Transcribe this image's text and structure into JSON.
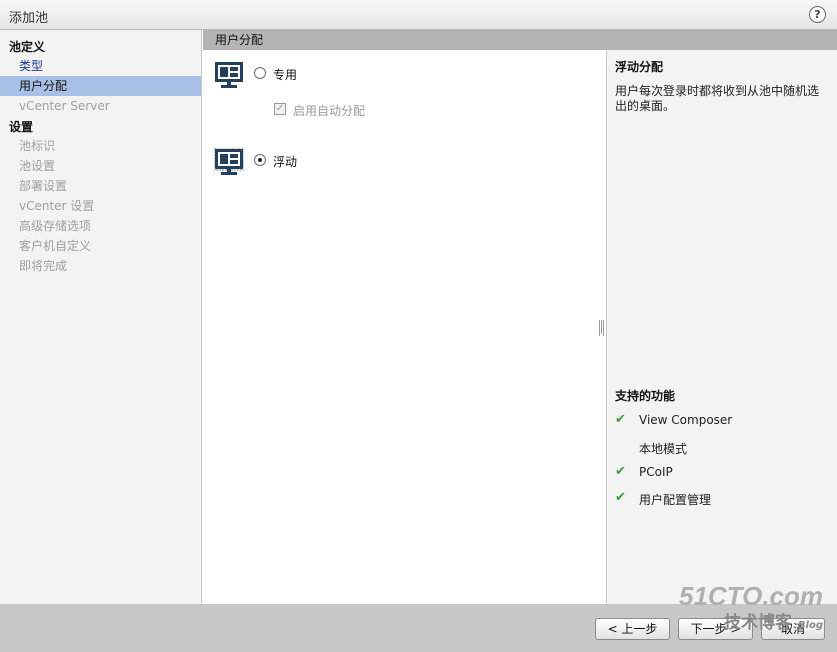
{
  "window": {
    "title": "添加池",
    "help_glyph": "?"
  },
  "sidebar": {
    "group_definition": "池定义",
    "items_definition": [
      {
        "label": "类型",
        "state": "done"
      },
      {
        "label": "用户分配",
        "state": "active"
      },
      {
        "label": "vCenter Server",
        "state": "pending"
      }
    ],
    "group_settings": "设置",
    "items_settings": [
      {
        "label": "池标识"
      },
      {
        "label": "池设置"
      },
      {
        "label": "部署设置"
      },
      {
        "label": "vCenter 设置"
      },
      {
        "label": "高级存储选项"
      },
      {
        "label": "客户机自定义"
      },
      {
        "label": "即将完成"
      }
    ]
  },
  "main": {
    "header": "用户分配",
    "dedicated": {
      "label": "专用",
      "selected": false
    },
    "auto_assign": {
      "label": "启用自动分配",
      "checked": true,
      "disabled": true
    },
    "floating": {
      "label": "浮动",
      "selected": true
    }
  },
  "info": {
    "title": "浮动分配",
    "description": "用户每次登录时都将收到从池中随机选出的桌面。",
    "features_title": "支持的功能",
    "features": [
      {
        "label": "View Composer",
        "supported": true
      },
      {
        "label": "本地模式",
        "supported": false
      },
      {
        "label": "PCoIP",
        "supported": true
      },
      {
        "label": "用户配置管理",
        "supported": true
      }
    ]
  },
  "footer": {
    "back": "< 上一步",
    "next": "下一步 >",
    "cancel": "取消"
  },
  "watermark": {
    "line1": "51CTO.com",
    "line2": "技术博客",
    "line3": "Blog"
  },
  "colors": {
    "active_nav": "#a9c0e6",
    "check": "#3c9a3c",
    "header_bar": "#b4b4b4"
  }
}
